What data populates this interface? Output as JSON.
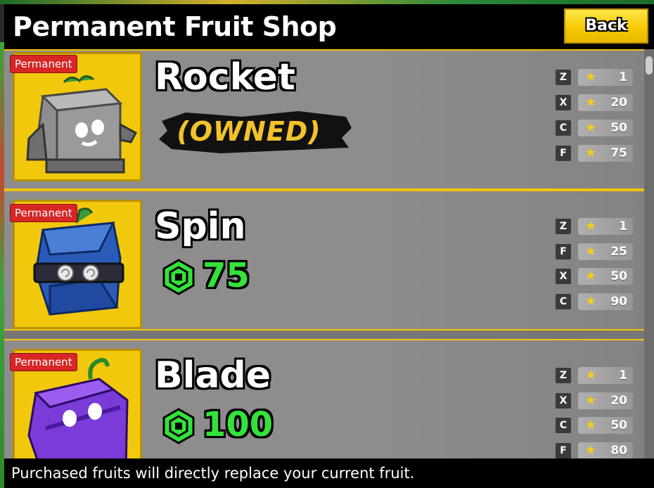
{
  "title": "Permanent Fruit Shop",
  "back_label": "Back",
  "footer_note": "Purchased fruits will directly replace your current fruit.",
  "colors": {
    "accent": "#f0c40a",
    "price": "#33e33a",
    "tag": "#d62626",
    "owned": "#f2c22a"
  },
  "fruits": [
    {
      "tag": "Permanent",
      "name": "Rocket",
      "status": "(OWNED)",
      "price": null,
      "icon": "rocket-fruit-icon",
      "moves": [
        {
          "key": "Z",
          "level": "1"
        },
        {
          "key": "X",
          "level": "20"
        },
        {
          "key": "C",
          "level": "50"
        },
        {
          "key": "F",
          "level": "75"
        }
      ]
    },
    {
      "tag": "Permanent",
      "name": "Spin",
      "status": null,
      "price": "75",
      "icon": "spin-fruit-icon",
      "moves": [
        {
          "key": "Z",
          "level": "1"
        },
        {
          "key": "F",
          "level": "25"
        },
        {
          "key": "X",
          "level": "50"
        },
        {
          "key": "C",
          "level": "90"
        }
      ]
    },
    {
      "tag": "Permanent",
      "name": "Blade",
      "status": null,
      "price": "100",
      "icon": "blade-fruit-icon",
      "moves": [
        {
          "key": "Z",
          "level": "1"
        },
        {
          "key": "X",
          "level": "20"
        },
        {
          "key": "C",
          "level": "50"
        },
        {
          "key": "F",
          "level": "80"
        }
      ]
    }
  ]
}
